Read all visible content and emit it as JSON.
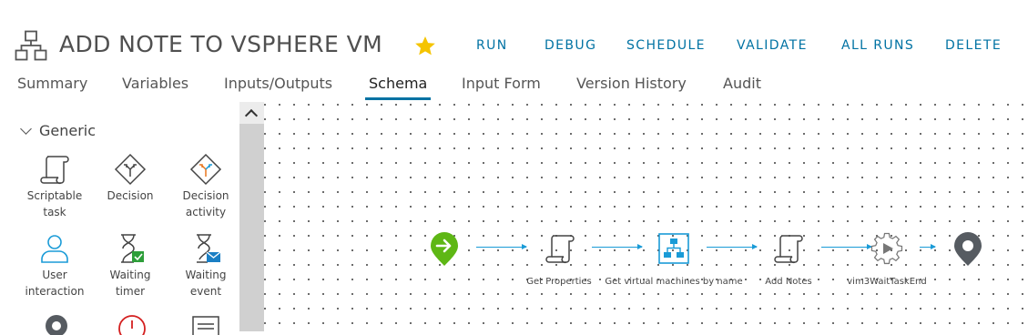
{
  "header": {
    "icon": "workflow-icon",
    "title": "ADD NOTE TO VSPHERE VM",
    "favorite_icon": "star-icon",
    "favorite_color": "#f5c400",
    "actions": [
      "RUN",
      "DEBUG",
      "SCHEDULE",
      "VALIDATE",
      "ALL RUNS",
      "DELETE"
    ]
  },
  "tabs": [
    "Summary",
    "Variables",
    "Inputs/Outputs",
    "Schema",
    "Input Form",
    "Version History",
    "Audit"
  ],
  "active_tab": "Schema",
  "palette": {
    "group": "Generic",
    "items": [
      {
        "label1": "Scriptable",
        "label2": "task",
        "icon": "scroll-icon"
      },
      {
        "label1": "Decision",
        "label2": "",
        "icon": "decision-diamond-icon"
      },
      {
        "label1": "Decision",
        "label2": "activity",
        "icon": "decision-activity-icon"
      },
      {
        "label1": "User",
        "label2": "interaction",
        "icon": "user-icon"
      },
      {
        "label1": "Waiting",
        "label2": "timer",
        "icon": "hourglass-calendar-icon"
      },
      {
        "label1": "Waiting",
        "label2": "event",
        "icon": "hourglass-mail-icon"
      }
    ]
  },
  "schema": {
    "nodes": [
      {
        "type": "start",
        "label": ""
      },
      {
        "type": "scriptable-task",
        "label": "Get Properties"
      },
      {
        "type": "workflow",
        "label": "Get virtual machines by name"
      },
      {
        "type": "scriptable-task",
        "label": "Add Notes"
      },
      {
        "type": "action",
        "label": "vim3WaitTaskEnd"
      },
      {
        "type": "end",
        "label": ""
      }
    ]
  },
  "colors": {
    "accent": "#0072a3",
    "start": "#5eb715",
    "connector": "#1a9bd7",
    "end": "#565b61"
  }
}
